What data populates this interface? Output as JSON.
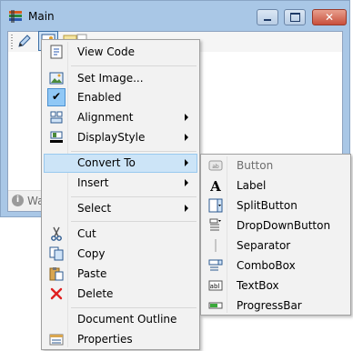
{
  "window": {
    "title": "Main",
    "status_text": "Wa"
  },
  "main_menu": [
    {
      "label": "View Code",
      "icon": "code-file-icon",
      "submenu": false
    },
    {
      "label": "Set Image...",
      "icon": "image-icon",
      "submenu": false
    },
    {
      "label": "Enabled",
      "icon": "check-icon",
      "checked": true,
      "submenu": false
    },
    {
      "label": "Alignment",
      "icon": "alignment-icon",
      "submenu": true
    },
    {
      "label": "DisplayStyle",
      "icon": "display-style-icon",
      "submenu": true
    },
    {
      "label": "Convert To",
      "icon": "",
      "submenu": true,
      "highlighted": true
    },
    {
      "label": "Insert",
      "icon": "",
      "submenu": true
    },
    {
      "label": "Select",
      "icon": "",
      "submenu": true
    },
    {
      "label": "Cut",
      "icon": "scissors-icon",
      "submenu": false
    },
    {
      "label": "Copy",
      "icon": "copy-icon",
      "submenu": false
    },
    {
      "label": "Paste",
      "icon": "paste-icon",
      "submenu": false
    },
    {
      "label": "Delete",
      "icon": "delete-icon",
      "submenu": false
    },
    {
      "label": "Document Outline",
      "icon": "",
      "submenu": false
    },
    {
      "label": "Properties",
      "icon": "properties-icon",
      "submenu": false
    }
  ],
  "convert_submenu": [
    {
      "label": "Button",
      "icon": "button-icon",
      "disabled": true
    },
    {
      "label": "Label",
      "icon": "label-icon"
    },
    {
      "label": "SplitButton",
      "icon": "split-button-icon"
    },
    {
      "label": "DropDownButton",
      "icon": "dropdown-button-icon"
    },
    {
      "label": "Separator",
      "icon": "separator-icon"
    },
    {
      "label": "ComboBox",
      "icon": "combobox-icon"
    },
    {
      "label": "TextBox",
      "icon": "textbox-icon"
    },
    {
      "label": "ProgressBar",
      "icon": "progressbar-icon"
    }
  ],
  "colors": {
    "highlight": "#cce4f7",
    "highlight_border": "#99c9ef",
    "menu_bg": "#f2f2f2",
    "title_bar": "#a9c7e6",
    "close_button": "#c8503c"
  }
}
